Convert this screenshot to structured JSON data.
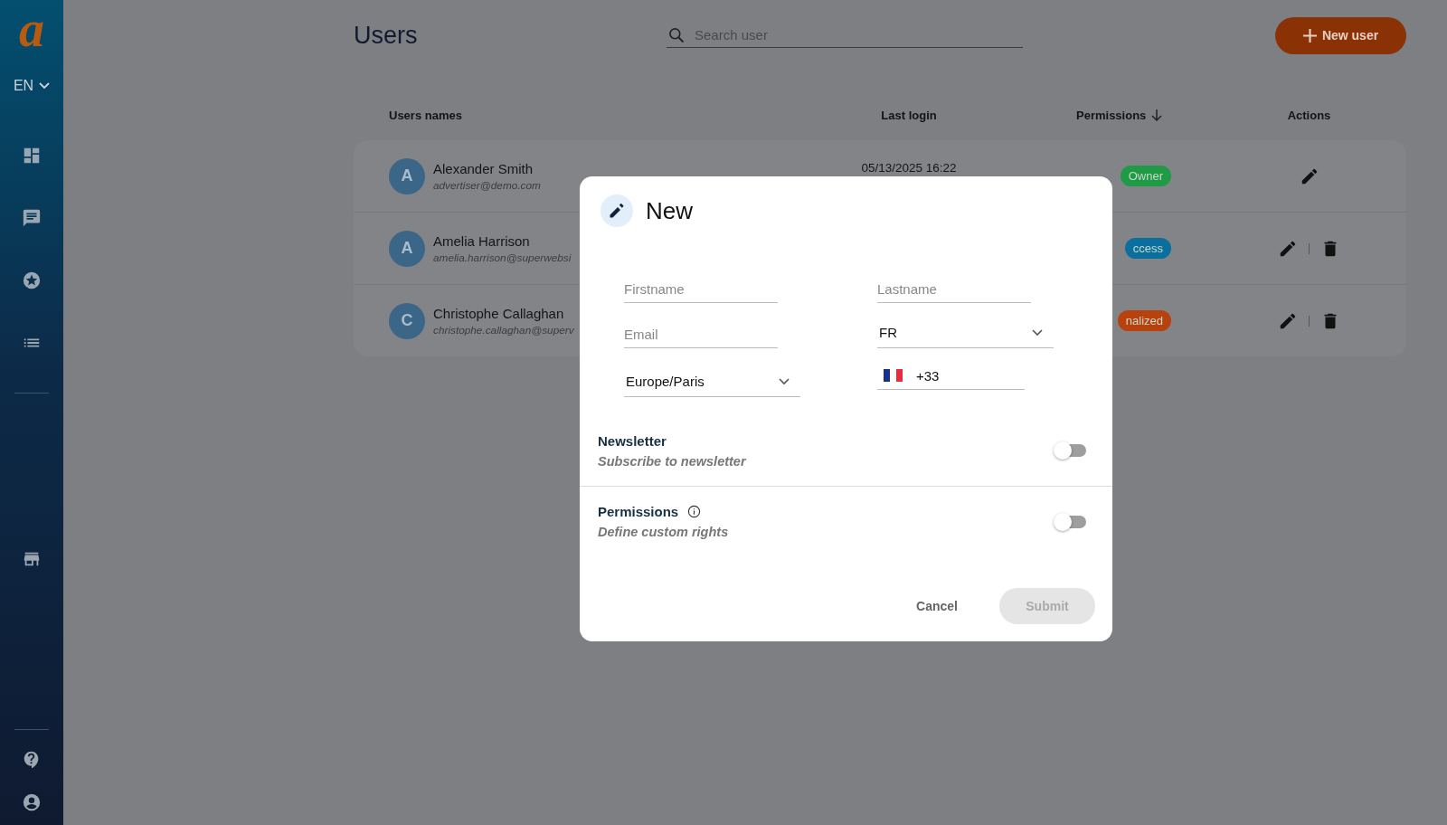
{
  "sidebar": {
    "logo": "a",
    "language": "EN"
  },
  "page": {
    "title": "Users",
    "search": {
      "placeholder": "Search user"
    },
    "new_button": "New user"
  },
  "table": {
    "columns": [
      "Users names",
      "Last login",
      "Permissions",
      "Actions"
    ],
    "rows": [
      {
        "initial": "A",
        "name": "Alexander Smith",
        "email": "advertiser@demo.com",
        "last_login": "05/13/2025 16:22",
        "permission": "Owner",
        "color": "#1f9a45",
        "deletable": false
      },
      {
        "initial": "A",
        "name": "Amelia Harrison",
        "email": "amelia.harrison@superwebsi",
        "permission": "ccess",
        "color": "#0b6f9e",
        "deletable": true
      },
      {
        "initial": "C",
        "name": "Christophe Callaghan",
        "email": "christophe.callaghan@superv",
        "permission": "nalized",
        "color": "#b8420e",
        "deletable": true
      }
    ]
  },
  "dialog": {
    "title": "New",
    "fields": [
      {
        "kind": "input",
        "placeholder": "Firstname"
      },
      {
        "kind": "input",
        "placeholder": "Lastname"
      },
      {
        "kind": "input",
        "placeholder": "Email"
      },
      {
        "kind": "select",
        "value": "FR"
      },
      {
        "kind": "select",
        "value": "Europe/Paris"
      },
      {
        "kind": "phone",
        "value": "+33"
      }
    ],
    "toggles": [
      {
        "label": "Newsletter",
        "hint": "Subscribe to newsletter",
        "info": false,
        "on": false
      },
      {
        "label": "Permissions",
        "hint": "Define custom rights",
        "info": true,
        "on": false
      }
    ],
    "cancel": "Cancel",
    "submit": {
      "label": "Submit",
      "disabled": true
    }
  }
}
